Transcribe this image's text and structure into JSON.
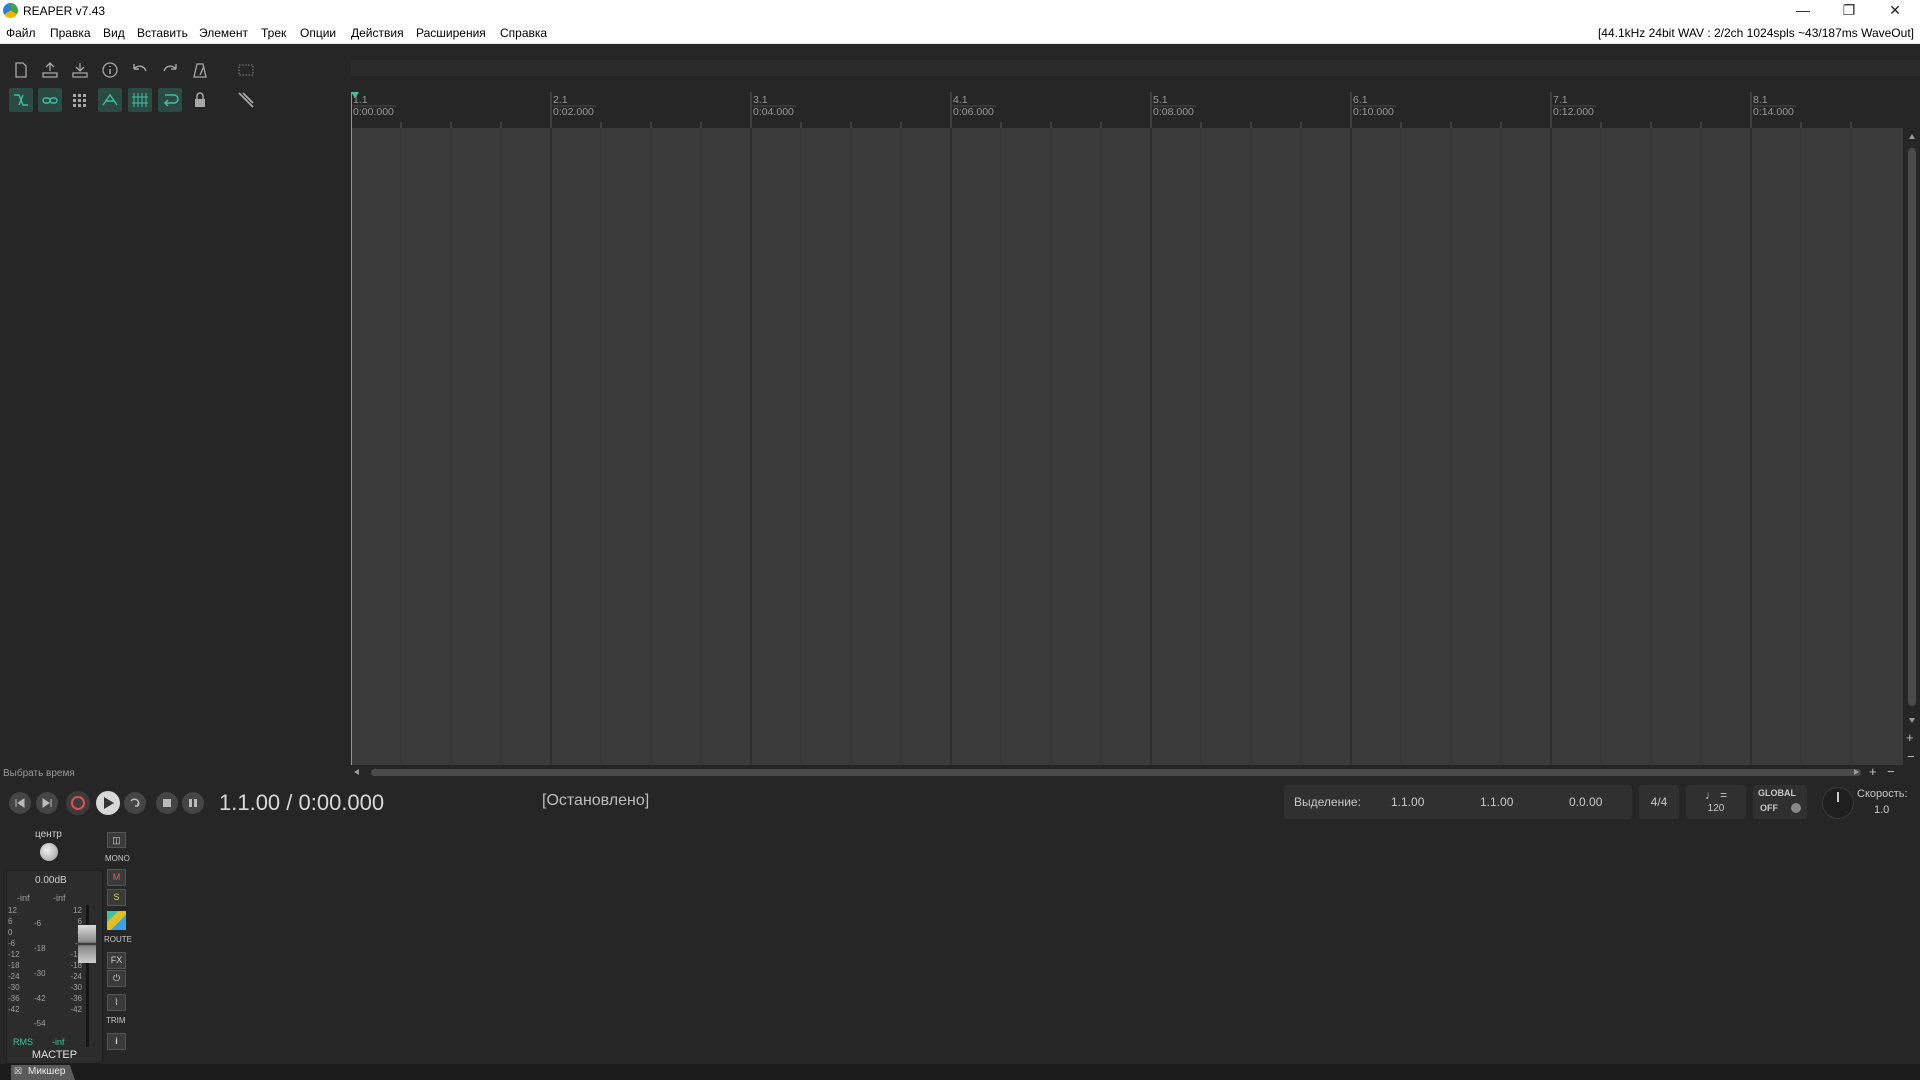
{
  "window": {
    "title": "REAPER v7.43",
    "audio_info": "[44.1kHz 24bit WAV : 2/2ch 1024spls ~43/187ms WaveOut]",
    "controls": [
      "minimize",
      "restore",
      "close"
    ]
  },
  "menu": [
    "Файл",
    "Правка",
    "Вид",
    "Вставить",
    "Элемент",
    "Трек",
    "Опции",
    "Действия",
    "Расширения",
    "Справка"
  ],
  "toolbar": {
    "row1_icons": [
      "new-project-icon",
      "open-project-icon",
      "save-project-icon",
      "project-info-icon",
      "undo-icon",
      "redo-icon",
      "metronome-icon",
      "grid-view-icon"
    ],
    "row2_icons": [
      "ripple-edit-icon",
      "item-grouping-icon",
      "snap-grid-icon",
      "envelope-link-icon",
      "grid-lines-icon",
      "loop-icon",
      "lock-icon",
      "cut-tool-icon"
    ]
  },
  "ruler": {
    "bars": [
      {
        "bar": "1.1",
        "time": "0:00.000"
      },
      {
        "bar": "2.1",
        "time": "0:02.000"
      },
      {
        "bar": "3.1",
        "time": "0:04.000"
      },
      {
        "bar": "4.1",
        "time": "0:06.000"
      },
      {
        "bar": "5.1",
        "time": "0:08.000"
      },
      {
        "bar": "6.1",
        "time": "0:10.000"
      },
      {
        "bar": "7.1",
        "time": "0:12.000"
      },
      {
        "bar": "8.1",
        "time": "0:14.000"
      }
    ]
  },
  "arrange": {
    "select_time_label": "Выбрать время"
  },
  "transport": {
    "buttons": [
      "go-to-start-icon",
      "go-to-end-icon",
      "record-icon",
      "play-icon",
      "repeat-icon",
      "stop-icon",
      "pause-icon"
    ],
    "position": "1.1.00 / 0:00.000",
    "status": "[Остановлено]",
    "selection_label": "Выделение:",
    "selection_start": "1.1.00",
    "selection_end": "1.1.00",
    "selection_length": "0.0.00",
    "time_signature": "4/4",
    "tempo_symbol": "♩ =",
    "tempo": "120",
    "global_label": "GLOBAL",
    "global_state": "OFF",
    "playrate_label": "Скорость:",
    "playrate_value": "1.0"
  },
  "master": {
    "pan_label": "центр",
    "volume": "0.00dB",
    "peak_left": "-inf",
    "peak_right": "-inf",
    "scale_left": [
      "12",
      "6",
      "0",
      "-6",
      "-12",
      "-18",
      "-24",
      "-30",
      "-36",
      "-42"
    ],
    "scale_mid": [
      "-6",
      "-18",
      "-30",
      "-42",
      "-54"
    ],
    "scale_right": [
      "12",
      "6",
      "0",
      "-6",
      "-12",
      "-18",
      "-24",
      "-30",
      "-36",
      "-42"
    ],
    "mono_label": "MONO",
    "mute_label": "M",
    "solo_label": "S",
    "route_label": "ROUTE",
    "fx_label": "FX",
    "trim_label": "TRIM",
    "info_label": "i",
    "rms_label": "RMS",
    "rms_value": "-inf",
    "name": "МАСТЕР"
  },
  "bottom": {
    "mixer_tab": "Микшер"
  },
  "colors": {
    "accent": "#40c0a0",
    "record": "#e05050",
    "background": "#262626",
    "arrange_bg": "#3b3b3b"
  }
}
